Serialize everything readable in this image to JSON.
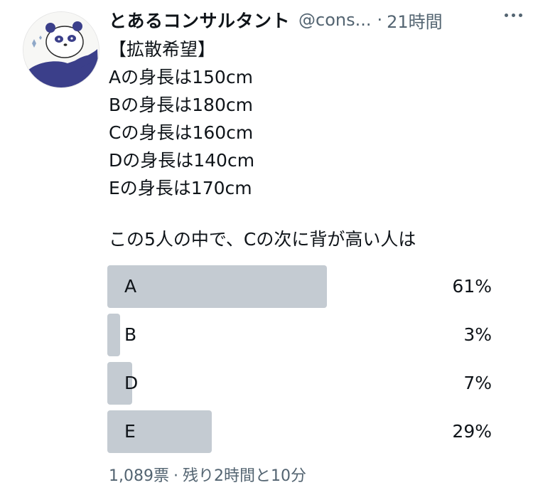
{
  "author": {
    "display_name": "とあるコンサルタント",
    "handle": "@cons...",
    "separator": "·",
    "time": "21時間",
    "avatar_icon": "panda-avatar-icon"
  },
  "tweet": {
    "lines": [
      "【拡散希望】",
      "Aの身長は150cm",
      "Bの身長は180cm",
      "Cの身長は160cm",
      "Dの身長は140cm",
      "Eの身長は170cm"
    ],
    "question": "この5人の中で、Cの次に背が高い人は"
  },
  "poll": {
    "options": [
      {
        "label": "A",
        "percent": "61%",
        "value": 61
      },
      {
        "label": "B",
        "percent": "3%",
        "value": 3
      },
      {
        "label": "D",
        "percent": "7%",
        "value": 7
      },
      {
        "label": "E",
        "percent": "29%",
        "value": 29
      }
    ],
    "bar_color": "#c4cbd2",
    "votes": "1,089票",
    "separator": "·",
    "remaining": "残り2時間と10分"
  },
  "colors": {
    "text": "#0f1419",
    "secondary": "#536471"
  }
}
